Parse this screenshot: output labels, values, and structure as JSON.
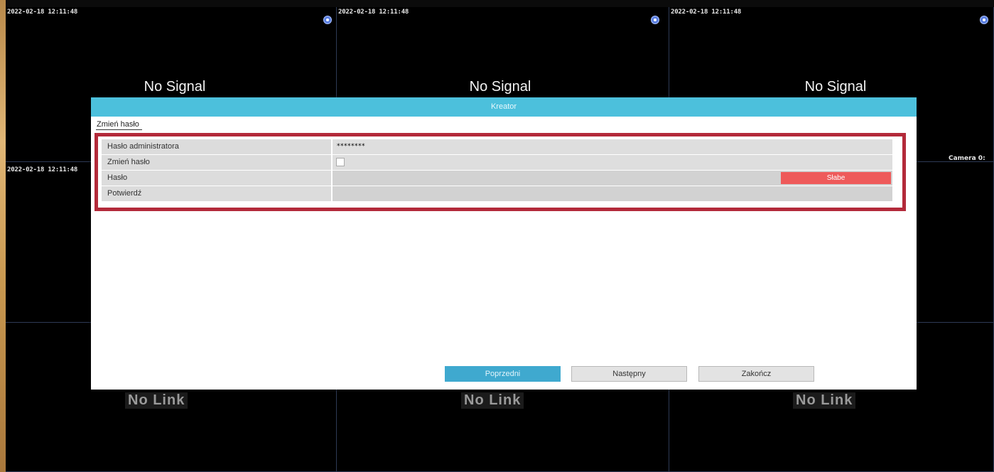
{
  "cameras": {
    "timestamp": "2022-02-18 12:11:48",
    "no_signal": "No Signal",
    "no_link": "No Link",
    "camera_label": "Camera 0:"
  },
  "dialog": {
    "title": "Kreator",
    "tab": "Zmień hasło",
    "fields": [
      {
        "label": "Hasło administratora",
        "value": "********"
      },
      {
        "label": "Zmień hasło",
        "checked": false
      },
      {
        "label": "Hasło",
        "value": "",
        "strength": "Słabe"
      },
      {
        "label": "Potwierdź",
        "value": ""
      }
    ],
    "buttons": {
      "previous": "Poprzedni",
      "next": "Następny",
      "finish": "Zakończ"
    }
  },
  "colors": {
    "title_bar": "#4cc0dc",
    "highlight_frame": "#b32a3a",
    "strength_weak": "#ee5a5a",
    "primary_button": "#3fa9cf"
  }
}
